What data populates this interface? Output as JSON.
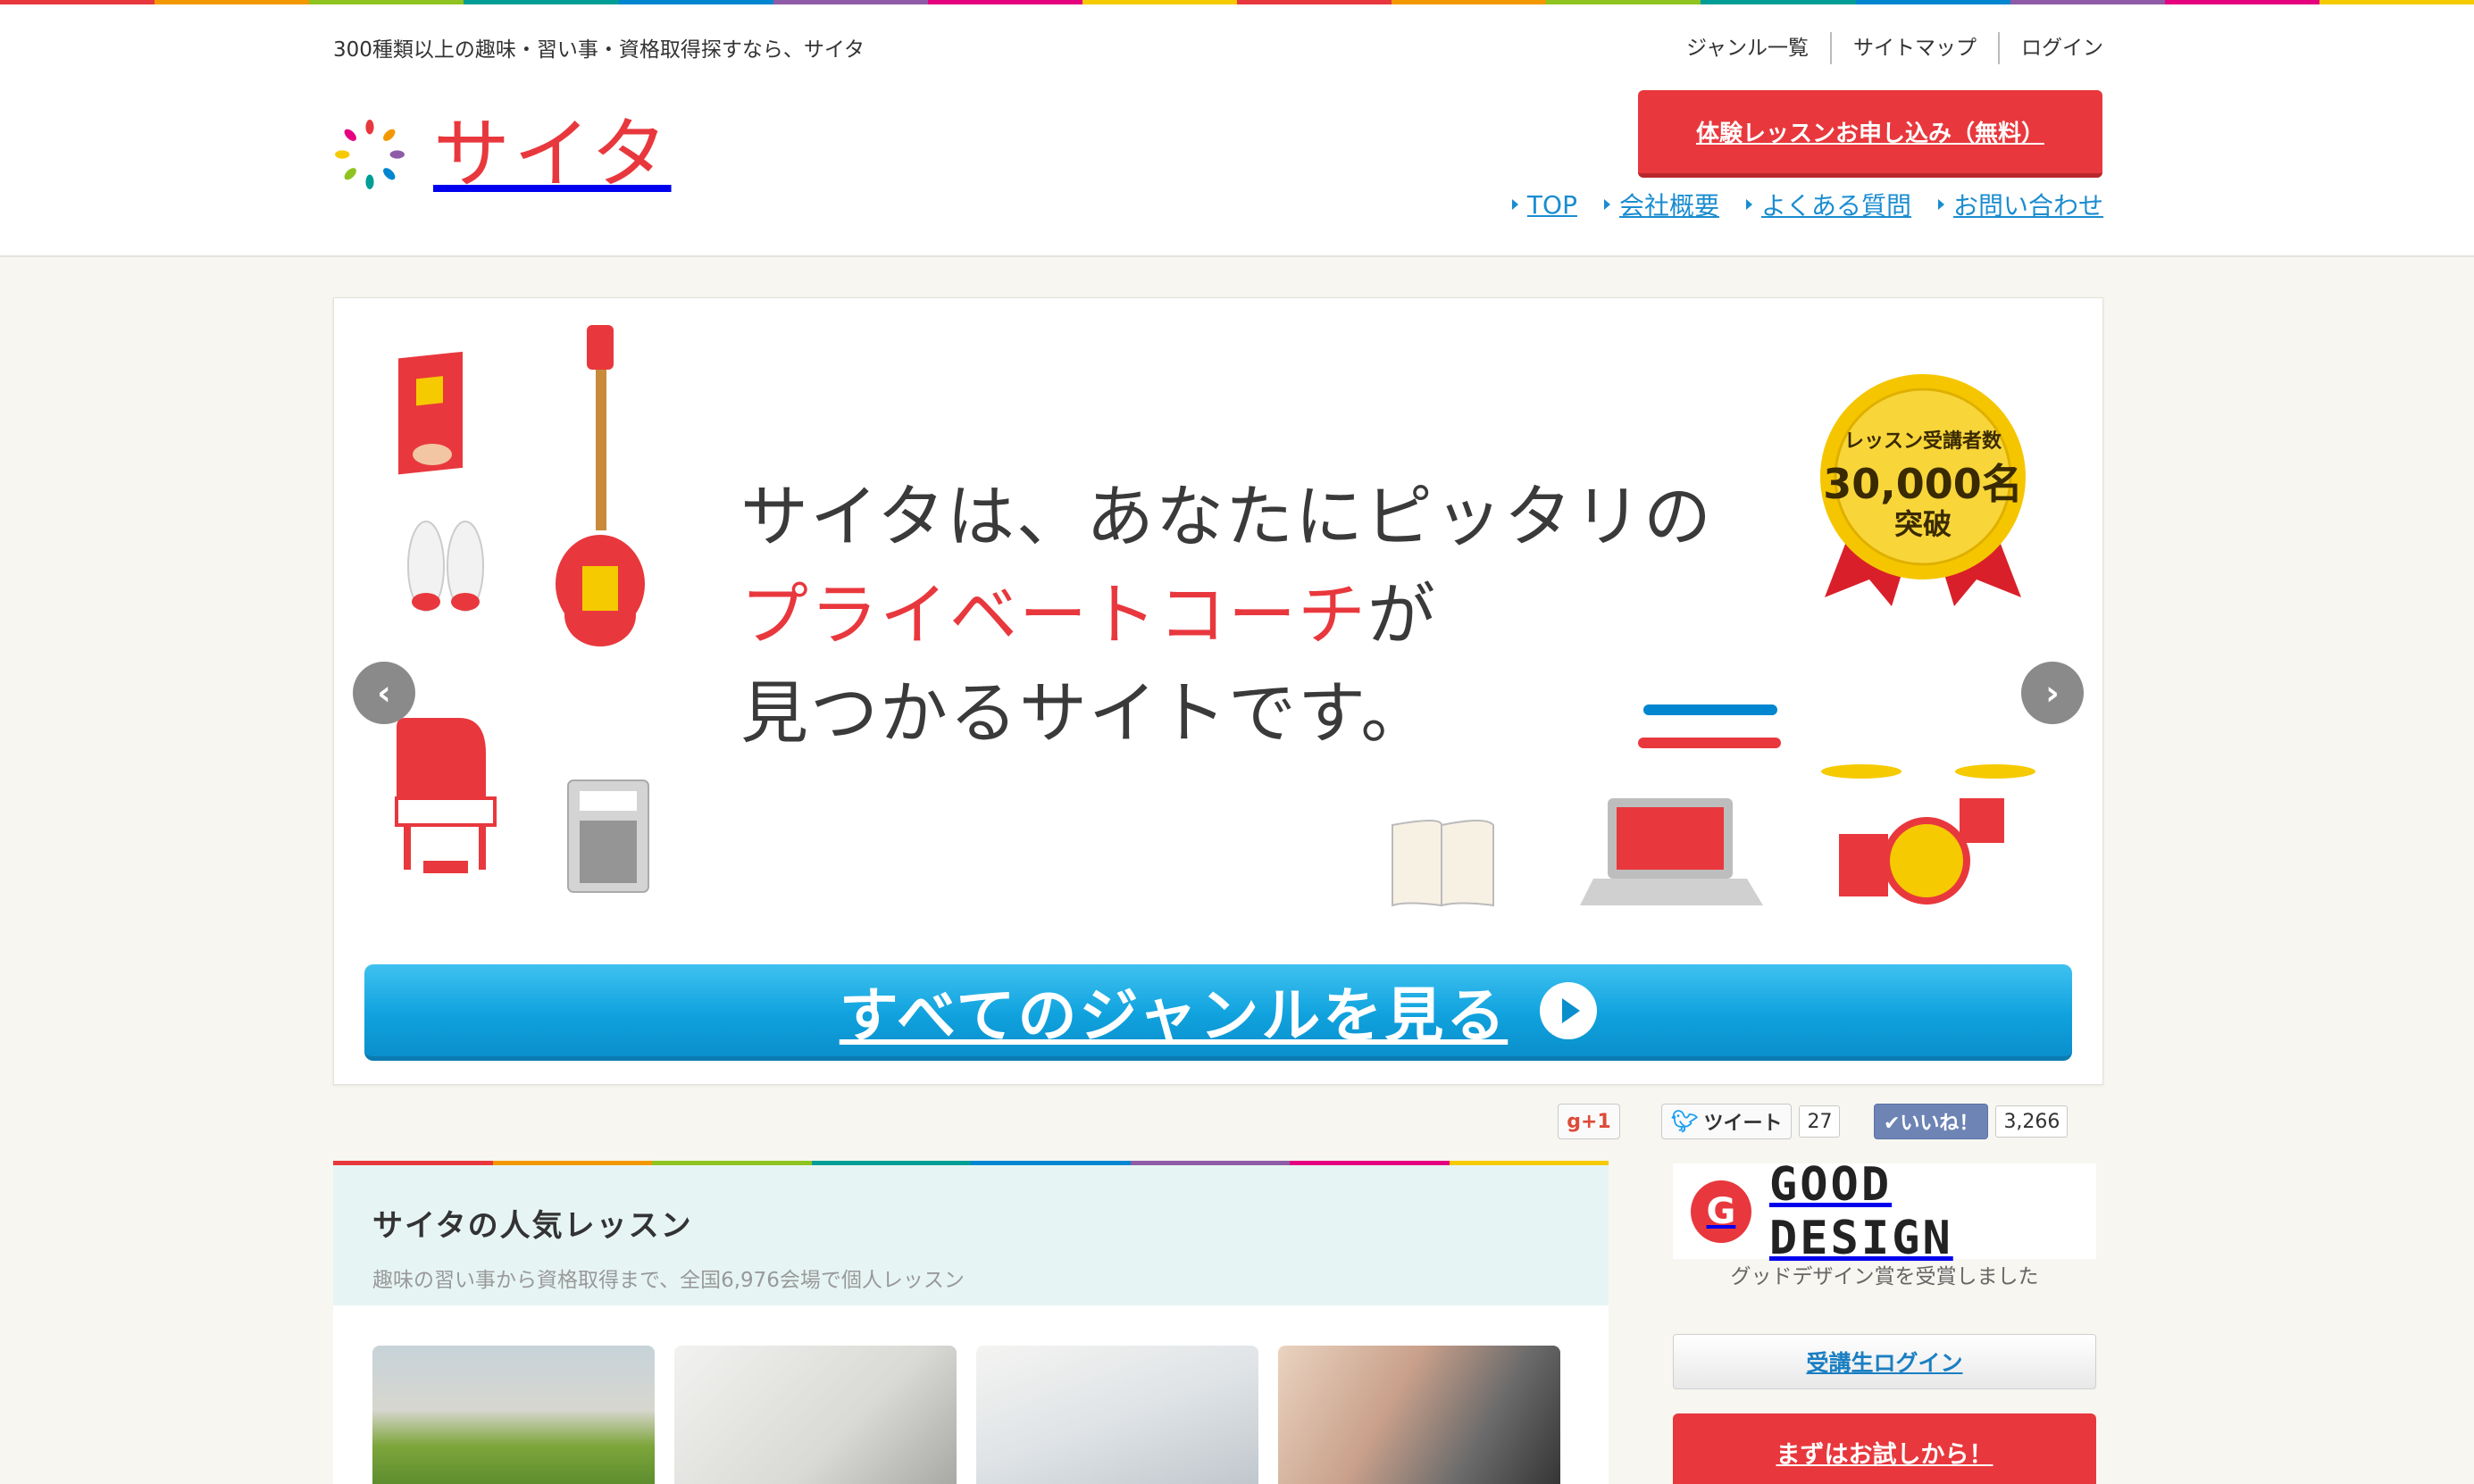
{
  "header": {
    "tagline": "300種類以上の趣味・習い事・資格取得探すなら、サイタ",
    "util_nav": [
      "ジャンル一覧",
      "サイトマップ",
      "ログイン"
    ],
    "logo_text": "サイタ",
    "cta_label": "体験レッスンお申し込み（無料）",
    "main_nav": [
      "TOP",
      "会社概要",
      "よくある質問",
      "お問い合わせ"
    ]
  },
  "hero": {
    "line1": "サイタは、あなたにピッタリの",
    "line2_red": "プライベートコーチ",
    "line2_rest": "が",
    "line3": "見つかるサイトです。",
    "badge_line1": "レッスン受講者数",
    "badge_line2": "30,000名",
    "badge_line3": "突破",
    "genre_button": "すべてのジャンルを見る",
    "prev_label": "‹",
    "next_label": "›"
  },
  "social": {
    "gplus_label": "g+1",
    "tweet_label": "ツイート",
    "tweet_count": "27",
    "like_label": "✔いいね！",
    "like_count": "3,266"
  },
  "popular": {
    "title": "サイタの人気レッスン",
    "subtitle": "趣味の習い事から資格取得まで、全国6,976会場で個人レッスン"
  },
  "sidebar": {
    "gd_mark": "G",
    "gd_text": "GOOD DESIGN",
    "gd_caption": "グッドデザイン賞を受賞しました",
    "login_label": "受講生ログイン",
    "trial_label": "まずはお試しから！"
  },
  "colors": {
    "brand_red": "#e8383d",
    "link_blue": "#1a8cd0",
    "genre_blue": "#10a2de",
    "rainbow": [
      "#e8383d",
      "#f39800",
      "#8fc31f",
      "#009e96",
      "#0086d1",
      "#8f5ba6",
      "#e4007f",
      "#f6ca00"
    ]
  }
}
